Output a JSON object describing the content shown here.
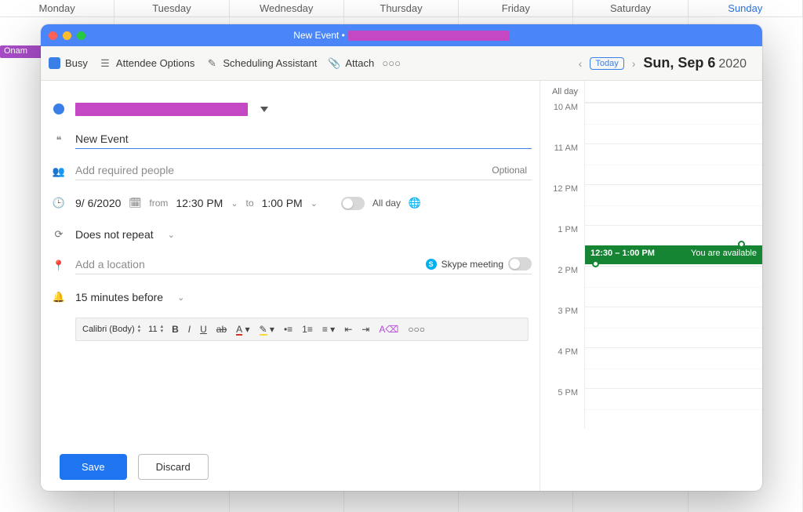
{
  "background": {
    "days": [
      "Monday",
      "Tuesday",
      "Wednesday",
      "Thursday",
      "Friday",
      "Saturday",
      "Sunday"
    ],
    "active_day_index": 6,
    "event_label": "Onam"
  },
  "window": {
    "title_prefix": "New Event •"
  },
  "toolbar": {
    "busy": "Busy",
    "attendee_options": "Attendee Options",
    "scheduling_assistant": "Scheduling Assistant",
    "attach": "Attach",
    "today": "Today",
    "date_bold": "Sun, Sep 6",
    "date_year": "2020"
  },
  "form": {
    "title_placeholder": "New Event",
    "people_placeholder": "Add required people",
    "optional": "Optional",
    "date": "9/ 6/2020",
    "from_label": "from",
    "from_time": "12:30 PM",
    "to_label": "to",
    "to_time": "1:00 PM",
    "all_day": "All day",
    "repeat": "Does not repeat",
    "location_placeholder": "Add a location",
    "skype": "Skype meeting",
    "reminder": "15 minutes before"
  },
  "rte": {
    "font": "Calibri (Body)",
    "size": "11"
  },
  "footer": {
    "save": "Save",
    "discard": "Discard"
  },
  "sidecal": {
    "all_day": "All day",
    "hours": [
      "10 AM",
      "11 AM",
      "12 PM",
      "1 PM",
      "2 PM",
      "3 PM",
      "4 PM",
      "5 PM"
    ],
    "event_time": "12:30 – 1:00 PM",
    "event_status": "You are available"
  }
}
